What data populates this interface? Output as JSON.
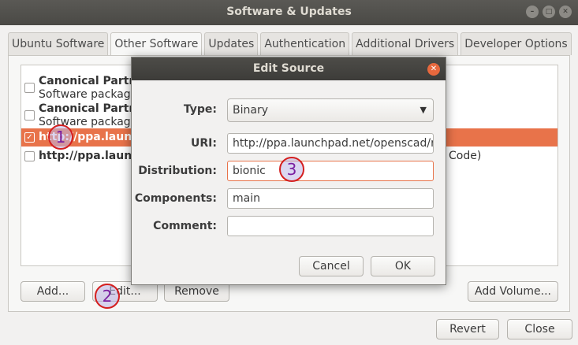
{
  "window": {
    "title": "Software & Updates"
  },
  "tabs": [
    {
      "label": "Ubuntu Software"
    },
    {
      "label": "Other Software"
    },
    {
      "label": "Updates"
    },
    {
      "label": "Authentication"
    },
    {
      "label": "Additional Drivers"
    },
    {
      "label": "Developer Options"
    }
  ],
  "sources": [
    {
      "line1": "Canonical Partne",
      "line2": "Software package",
      "checked": false
    },
    {
      "line1": "Canonical Partne",
      "line2": "Software package",
      "checked": false
    },
    {
      "line1": "http://ppa.launc",
      "checked": true
    },
    {
      "line1": "http://ppa.launc",
      "tail": "Code)",
      "checked": false
    }
  ],
  "main_buttons": {
    "add": "Add...",
    "edit": "Edit...",
    "remove": "Remove",
    "add_volume": "Add Volume..."
  },
  "footer_buttons": {
    "revert": "Revert",
    "close": "Close"
  },
  "dialog": {
    "title": "Edit Source",
    "type_label": "Type:",
    "type_value": "Binary",
    "uri_label": "URI:",
    "uri_value": "http://ppa.launchpad.net/openscad/r",
    "distribution_label": "Distribution:",
    "distribution_value": "bionic",
    "components_label": "Components:",
    "components_value": "main",
    "comment_label": "Comment:",
    "comment_value": "",
    "cancel": "Cancel",
    "ok": "OK"
  },
  "annotations": {
    "m1": "1",
    "m2": "2",
    "m3": "3"
  },
  "colors": {
    "accent": "#e8734a",
    "marker": "#d41f1f"
  }
}
